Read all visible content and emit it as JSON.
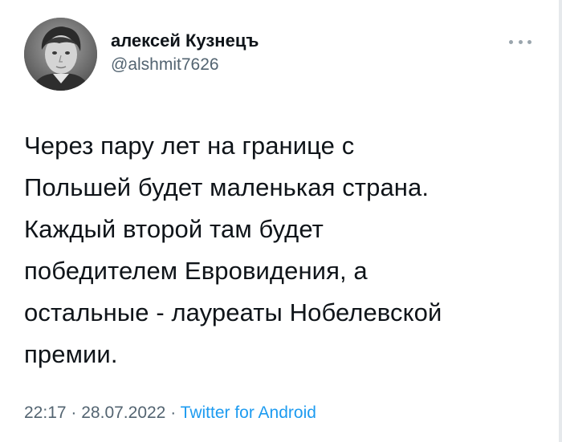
{
  "author": {
    "display_name": "алексей Кузнецъ",
    "handle": "@alshmit7626"
  },
  "tweet": {
    "lines": [
      "Через пару лет на границе с",
      "Польшей будет маленькая страна.",
      "Каждый второй там будет",
      "победителем Евровидения, а",
      "остальные - лауреаты Нобелевской",
      "премии."
    ],
    "time": "22:17",
    "separator": "·",
    "date": "28.07.2022",
    "source": "Twitter for Android"
  },
  "icons": {
    "more": "more-horizontal-icon"
  },
  "colors": {
    "text": "#0f1419",
    "secondary": "#536471",
    "link": "#1d9bf0"
  }
}
